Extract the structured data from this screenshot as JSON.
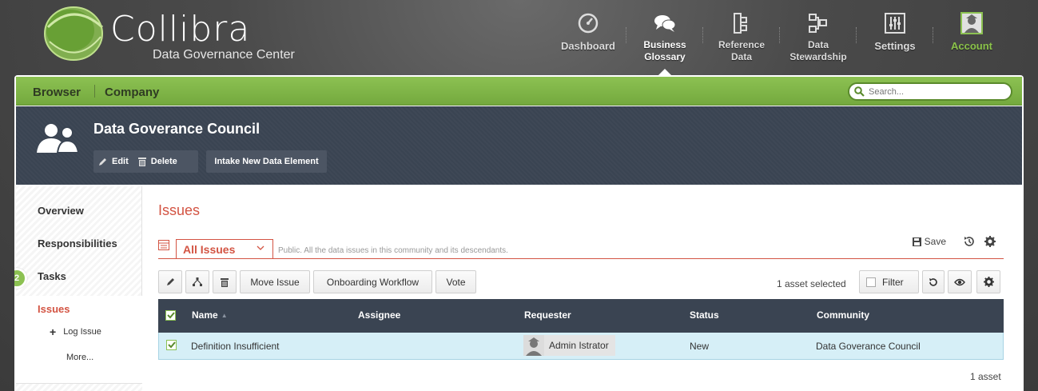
{
  "brand": {
    "name": "Collibra",
    "subtitle": "Data Governance Center"
  },
  "nav": {
    "items": [
      {
        "line1": "Dashboard",
        "line2": "",
        "icon": "dashboard-gauge-icon"
      },
      {
        "line1": "Business",
        "line2": "Glossary",
        "icon": "speech-bubbles-icon"
      },
      {
        "line1": "Reference",
        "line2": "Data",
        "icon": "reference-data-icon"
      },
      {
        "line1": "Data",
        "line2": "Stewardship",
        "icon": "stewardship-icon"
      },
      {
        "line1": "Settings",
        "line2": "",
        "icon": "sliders-icon"
      },
      {
        "line1": "Account",
        "line2": "",
        "icon": "user-avatar-icon"
      }
    ],
    "active": "Business Glossary"
  },
  "breadcrumb": {
    "browser": "Browser",
    "current": "Company"
  },
  "search": {
    "placeholder": "Search..."
  },
  "community": {
    "title": "Data Goverance Council",
    "edit_label": "Edit",
    "delete_label": "Delete",
    "intake_label": "Intake New Data Element"
  },
  "sidebar": {
    "items": [
      "Overview",
      "Responsibilities",
      "Tasks"
    ],
    "tasks_badge": "2",
    "active_item": "Issues",
    "sub_items": [
      "Log Issue",
      "More..."
    ]
  },
  "issues": {
    "title": "Issues",
    "view_name": "All Issues",
    "view_description": "Public. All the data issues in this community and its descendants.",
    "save_label": "Save",
    "toolbar": {
      "move_issue": "Move Issue",
      "onboarding_workflow": "Onboarding Workflow",
      "vote": "Vote",
      "selected_count": "1 asset selected",
      "filter": "Filter"
    },
    "columns": [
      "Name",
      "Assignee",
      "Requester",
      "Status",
      "Community"
    ],
    "rows": [
      {
        "name": "Definition Insufficient",
        "assignee": "",
        "requester": "Admin Istrator",
        "status": "New",
        "community": "Data Goverance Council",
        "checked": true
      }
    ],
    "asset_count": "1 asset"
  },
  "colors": {
    "brand_green": "#8cc152",
    "accent_red": "#d35443",
    "dark_header": "#3a4452",
    "row_selected": "#d6eff7"
  }
}
